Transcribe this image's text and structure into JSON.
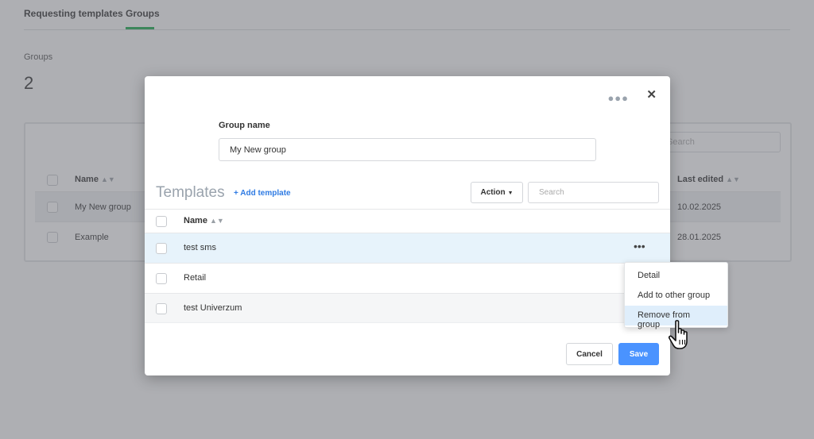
{
  "page": {
    "tabs": [
      "Requesting templates",
      "Groups"
    ],
    "count_label": "Groups",
    "count_value": "2",
    "search_placeholder": "Search",
    "table": {
      "col_name": "Name",
      "col_last_edited": "Last edited",
      "rows": [
        {
          "name": "My New group",
          "date": "10.02.2025"
        },
        {
          "name": "Example",
          "date": "28.01.2025"
        }
      ]
    }
  },
  "modal": {
    "more_icon": "more-horizontal-icon",
    "close_glyph": "✕",
    "group_name_label": "Group name",
    "group_name_value": "My New group",
    "templates_title": "Templates",
    "add_template": "+ Add template",
    "action_label": "Action",
    "search_placeholder": "Search",
    "col_name": "Name",
    "rows": [
      "test sms",
      "Retail",
      "test Univerzum"
    ],
    "row_menu_glyph": "•••",
    "cancel_label": "Cancel",
    "save_label": "Save"
  },
  "dropdown": {
    "items": [
      "Detail",
      "Add to other group",
      "Remove from group"
    ],
    "highlighted": "Remove from group"
  },
  "colors": {
    "accent_green": "#18a84a",
    "primary_blue": "#4a93ff",
    "link_blue": "#2f7be3",
    "row_highlight": "#e7f3fb"
  }
}
